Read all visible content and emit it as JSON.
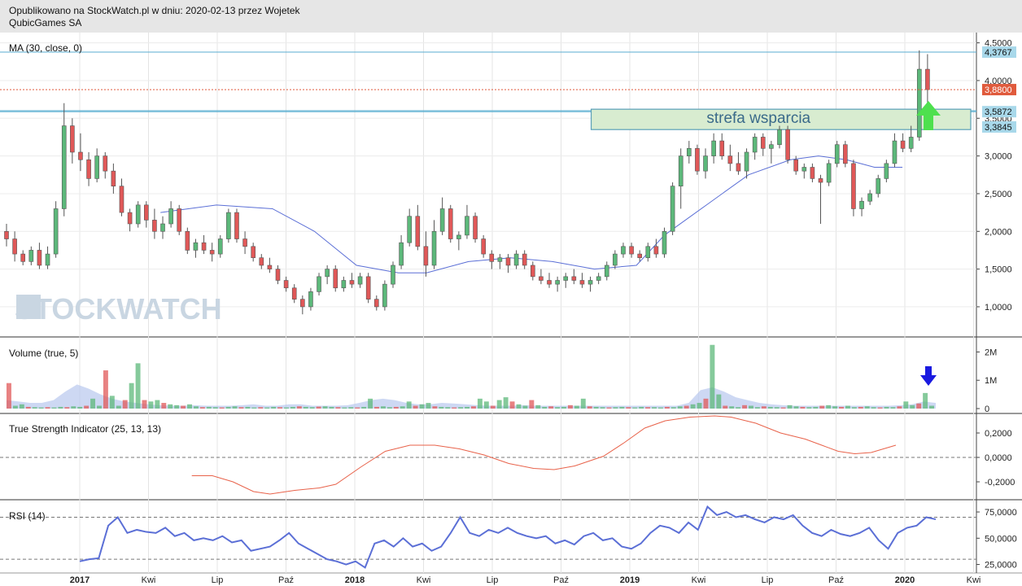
{
  "header": {
    "line1": "Opublikowano na StockWatch.pl w dniu: 2020-02-13 przez Wojetek",
    "line2": "QubicGames SA"
  },
  "watermark": "STOCKWATCH",
  "colors": {
    "up": "#5cb87a",
    "down": "#e05858",
    "ma": "#5b6fd6",
    "tsi": "#e8624a",
    "rsi": "#5b6fd6",
    "vol_ma": "#b8c8ee",
    "zone_fill": "#d8ecd0",
    "zone_border": "#5aa0b8",
    "hline": "#5aaed0",
    "price_line": "#e05a3c",
    "up_arrow": "#4ee04e",
    "down_arrow": "#1a1ae0"
  },
  "x_axis": {
    "tick_labels": [
      "2017",
      "Kwi",
      "Lip",
      "Paź",
      "2018",
      "Kwi",
      "Lip",
      "Paź",
      "2019",
      "Kwi",
      "Lip",
      "Paź",
      "2020",
      "Kwi"
    ]
  },
  "chart_data": [
    {
      "type": "candlestick",
      "title": "MA (30, close, 0)",
      "y_ticks": [
        "4,5000",
        "4,0000",
        "3,5000",
        "3,0000",
        "2,5000",
        "2,0000",
        "1,5000",
        "1,0000"
      ],
      "ylim": [
        0.6,
        4.55
      ],
      "price_labels": [
        {
          "value": 4.3767,
          "text": "4,3767",
          "kind": "line"
        },
        {
          "value": 3.88,
          "text": "3,8800",
          "kind": "price"
        },
        {
          "value": 3.5872,
          "text": "3,5872",
          "kind": "line"
        },
        {
          "value": 3.3845,
          "text": "3,3845",
          "kind": "ma"
        }
      ],
      "horizontal_lines": [
        4.3767,
        3.6,
        3.5872
      ],
      "zone": {
        "label": "strefa wsparcia",
        "low": 3.35,
        "high": 3.62,
        "from_week": 142
      },
      "candles_ohlc_weekly": [
        [
          2.0,
          2.1,
          1.8,
          1.9
        ],
        [
          1.9,
          2.0,
          1.6,
          1.7
        ],
        [
          1.7,
          1.75,
          1.55,
          1.6
        ],
        [
          1.6,
          1.8,
          1.55,
          1.75
        ],
        [
          1.75,
          1.85,
          1.5,
          1.55
        ],
        [
          1.55,
          1.8,
          1.5,
          1.7
        ],
        [
          1.7,
          2.4,
          1.65,
          2.3
        ],
        [
          2.3,
          3.7,
          2.2,
          3.4
        ],
        [
          3.4,
          3.5,
          2.9,
          3.05
        ],
        [
          3.05,
          3.3,
          2.8,
          2.95
        ],
        [
          2.95,
          3.05,
          2.6,
          2.7
        ],
        [
          2.7,
          3.1,
          2.65,
          3.0
        ],
        [
          3.0,
          3.05,
          2.7,
          2.8
        ],
        [
          2.8,
          2.9,
          2.5,
          2.6
        ],
        [
          2.6,
          2.7,
          2.2,
          2.25
        ],
        [
          2.25,
          2.3,
          2.0,
          2.1
        ],
        [
          2.1,
          2.4,
          2.05,
          2.35
        ],
        [
          2.35,
          2.4,
          2.05,
          2.15
        ],
        [
          2.15,
          2.3,
          1.9,
          2.0
        ],
        [
          2.0,
          2.2,
          1.9,
          2.1
        ],
        [
          2.1,
          2.4,
          2.05,
          2.3
        ],
        [
          2.3,
          2.35,
          1.95,
          2.0
        ],
        [
          2.0,
          2.05,
          1.7,
          1.75
        ],
        [
          1.75,
          1.9,
          1.65,
          1.85
        ],
        [
          1.85,
          1.95,
          1.7,
          1.75
        ],
        [
          1.75,
          1.85,
          1.6,
          1.7
        ],
        [
          1.7,
          1.95,
          1.65,
          1.9
        ],
        [
          1.9,
          2.3,
          1.85,
          2.25
        ],
        [
          2.25,
          2.3,
          1.85,
          1.9
        ],
        [
          1.9,
          2.0,
          1.7,
          1.8
        ],
        [
          1.8,
          1.85,
          1.6,
          1.65
        ],
        [
          1.65,
          1.7,
          1.5,
          1.55
        ],
        [
          1.55,
          1.65,
          1.45,
          1.5
        ],
        [
          1.5,
          1.55,
          1.3,
          1.35
        ],
        [
          1.35,
          1.4,
          1.2,
          1.25
        ],
        [
          1.25,
          1.3,
          1.05,
          1.1
        ],
        [
          1.1,
          1.15,
          0.9,
          1.0
        ],
        [
          1.0,
          1.25,
          0.95,
          1.2
        ],
        [
          1.2,
          1.45,
          1.15,
          1.4
        ],
        [
          1.4,
          1.55,
          1.3,
          1.5
        ],
        [
          1.5,
          1.55,
          1.2,
          1.25
        ],
        [
          1.25,
          1.4,
          1.2,
          1.35
        ],
        [
          1.35,
          1.45,
          1.25,
          1.3
        ],
        [
          1.3,
          1.45,
          1.25,
          1.4
        ],
        [
          1.4,
          1.45,
          1.05,
          1.1
        ],
        [
          1.1,
          1.15,
          0.95,
          1.0
        ],
        [
          1.0,
          1.35,
          0.95,
          1.3
        ],
        [
          1.3,
          1.6,
          1.25,
          1.55
        ],
        [
          1.55,
          1.95,
          1.5,
          1.85
        ],
        [
          1.85,
          2.3,
          1.8,
          2.2
        ],
        [
          2.2,
          2.35,
          1.75,
          1.8
        ],
        [
          1.8,
          2.0,
          1.4,
          1.55
        ],
        [
          1.55,
          2.15,
          1.5,
          2.0
        ],
        [
          2.0,
          2.45,
          1.95,
          2.3
        ],
        [
          2.3,
          2.35,
          1.85,
          1.9
        ],
        [
          1.9,
          2.0,
          1.75,
          1.95
        ],
        [
          1.95,
          2.35,
          1.9,
          2.2
        ],
        [
          2.2,
          2.25,
          1.85,
          1.9
        ],
        [
          1.9,
          1.95,
          1.65,
          1.7
        ],
        [
          1.7,
          1.75,
          1.5,
          1.6
        ],
        [
          1.6,
          1.7,
          1.5,
          1.65
        ],
        [
          1.65,
          1.7,
          1.45,
          1.55
        ],
        [
          1.55,
          1.75,
          1.5,
          1.7
        ],
        [
          1.7,
          1.75,
          1.5,
          1.55
        ],
        [
          1.55,
          1.6,
          1.35,
          1.4
        ],
        [
          1.4,
          1.5,
          1.3,
          1.35
        ],
        [
          1.35,
          1.45,
          1.25,
          1.3
        ],
        [
          1.3,
          1.4,
          1.2,
          1.35
        ],
        [
          1.35,
          1.45,
          1.25,
          1.4
        ],
        [
          1.4,
          1.5,
          1.3,
          1.35
        ],
        [
          1.35,
          1.45,
          1.25,
          1.3
        ],
        [
          1.3,
          1.4,
          1.2,
          1.35
        ],
        [
          1.35,
          1.45,
          1.3,
          1.4
        ],
        [
          1.4,
          1.6,
          1.35,
          1.55
        ],
        [
          1.55,
          1.75,
          1.5,
          1.7
        ],
        [
          1.7,
          1.85,
          1.65,
          1.8
        ],
        [
          1.8,
          1.85,
          1.65,
          1.7
        ],
        [
          1.7,
          1.75,
          1.6,
          1.65
        ],
        [
          1.65,
          1.85,
          1.6,
          1.8
        ],
        [
          1.8,
          1.9,
          1.65,
          1.7
        ],
        [
          1.7,
          2.05,
          1.65,
          2.0
        ],
        [
          2.0,
          2.65,
          1.95,
          2.6
        ],
        [
          2.6,
          3.1,
          2.3,
          3.0
        ],
        [
          3.0,
          3.2,
          2.9,
          3.1
        ],
        [
          3.1,
          3.15,
          2.75,
          2.8
        ],
        [
          2.8,
          3.1,
          2.7,
          3.0
        ],
        [
          3.0,
          3.3,
          2.9,
          3.2
        ],
        [
          3.2,
          3.3,
          2.95,
          3.0
        ],
        [
          3.0,
          3.15,
          2.8,
          2.9
        ],
        [
          2.9,
          3.05,
          2.75,
          2.8
        ],
        [
          2.8,
          3.1,
          2.7,
          3.05
        ],
        [
          3.05,
          3.3,
          2.95,
          3.25
        ],
        [
          3.25,
          3.3,
          3.0,
          3.1
        ],
        [
          3.1,
          3.2,
          2.9,
          3.15
        ],
        [
          3.15,
          3.4,
          3.1,
          3.35
        ],
        [
          3.35,
          3.4,
          2.9,
          2.95
        ],
        [
          2.95,
          3.0,
          2.75,
          2.8
        ],
        [
          2.8,
          2.9,
          2.7,
          2.85
        ],
        [
          2.85,
          2.9,
          2.65,
          2.7
        ],
        [
          2.7,
          2.75,
          2.1,
          2.65
        ],
        [
          2.65,
          2.95,
          2.6,
          2.9
        ],
        [
          2.9,
          3.2,
          2.85,
          3.15
        ],
        [
          3.15,
          3.2,
          2.85,
          2.9
        ],
        [
          2.9,
          2.95,
          2.2,
          2.3
        ],
        [
          2.3,
          2.45,
          2.2,
          2.4
        ],
        [
          2.4,
          2.55,
          2.35,
          2.5
        ],
        [
          2.5,
          2.75,
          2.45,
          2.7
        ],
        [
          2.7,
          2.95,
          2.65,
          2.9
        ],
        [
          2.9,
          3.3,
          2.85,
          3.2
        ],
        [
          3.2,
          3.3,
          3.05,
          3.1
        ],
        [
          3.1,
          3.4,
          3.05,
          3.25
        ],
        [
          3.25,
          4.4,
          3.2,
          4.15
        ],
        [
          4.15,
          4.35,
          3.7,
          3.88
        ]
      ],
      "ma_30": [
        [
          22,
          2.25
        ],
        [
          30,
          2.35
        ],
        [
          38,
          2.3
        ],
        [
          44,
          2.0
        ],
        [
          50,
          1.55
        ],
        [
          56,
          1.45
        ],
        [
          60,
          1.45
        ],
        [
          66,
          1.6
        ],
        [
          72,
          1.65
        ],
        [
          78,
          1.6
        ],
        [
          84,
          1.5
        ],
        [
          90,
          1.55
        ],
        [
          94,
          1.95
        ],
        [
          100,
          2.35
        ],
        [
          106,
          2.75
        ],
        [
          112,
          2.95
        ],
        [
          116,
          3.0
        ],
        [
          120,
          2.95
        ],
        [
          124,
          2.85
        ],
        [
          128,
          2.85
        ]
      ]
    },
    {
      "type": "bar",
      "title": "Volume (true, 5)",
      "y_ticks": [
        "2M",
        "1M",
        "0"
      ],
      "ylim": [
        0,
        2.3
      ],
      "values_millions": [
        0.9,
        0.1,
        0.15,
        0.06,
        0.05,
        0.04,
        0.05,
        0.04,
        0.06,
        0.05,
        0.08,
        0.06,
        0.1,
        0.35,
        0.1,
        1.35,
        0.45,
        0.1,
        0.3,
        0.9,
        1.6,
        0.3,
        0.25,
        0.3,
        0.2,
        0.15,
        0.12,
        0.1,
        0.15,
        0.08,
        0.05,
        0.06,
        0.05,
        0.04,
        0.06,
        0.08,
        0.05,
        0.06,
        0.04,
        0.05,
        0.04,
        0.06,
        0.05,
        0.04,
        0.06,
        0.08,
        0.06,
        0.05,
        0.07,
        0.08,
        0.06,
        0.05,
        0.04,
        0.05,
        0.04,
        0.06,
        0.35,
        0.06,
        0.08,
        0.05,
        0.06,
        0.08,
        0.25,
        0.1,
        0.15,
        0.2,
        0.08,
        0.06,
        0.05,
        0.04,
        0.05,
        0.06,
        0.08,
        0.35,
        0.25,
        0.1,
        0.3,
        0.4,
        0.25,
        0.15,
        0.1,
        0.3,
        0.12,
        0.06,
        0.08,
        0.05,
        0.06,
        0.12,
        0.1,
        0.35,
        0.08,
        0.06,
        0.05,
        0.04,
        0.05,
        0.06,
        0.05,
        0.04,
        0.06,
        0.05,
        0.05,
        0.04,
        0.06,
        0.05,
        0.08,
        0.1,
        0.15,
        0.2,
        0.35,
        2.25,
        0.5,
        0.1,
        0.08,
        0.05,
        0.12,
        0.1,
        0.05,
        0.08,
        0.06,
        0.05,
        0.04,
        0.12,
        0.08,
        0.06,
        0.05,
        0.06,
        0.1,
        0.12,
        0.08,
        0.06,
        0.1,
        0.05,
        0.06,
        0.08,
        0.05,
        0.04,
        0.06,
        0.05,
        0.08,
        0.25,
        0.12,
        0.18,
        0.55,
        0.1
      ],
      "volume_ma_millions": [
        0.3,
        0.25,
        0.2,
        0.2,
        0.3,
        0.6,
        0.85,
        0.7,
        0.5,
        0.35,
        0.25,
        0.2,
        0.15,
        0.12,
        0.1,
        0.1,
        0.12,
        0.1,
        0.1,
        0.1,
        0.12,
        0.15,
        0.1,
        0.1,
        0.15,
        0.15,
        0.1,
        0.1,
        0.1,
        0.12,
        0.2,
        0.3,
        0.35,
        0.3,
        0.2,
        0.15,
        0.15,
        0.2,
        0.18,
        0.15,
        0.12,
        0.1,
        0.1,
        0.1,
        0.12,
        0.1,
        0.1,
        0.1,
        0.1,
        0.1,
        0.1,
        0.1,
        0.1,
        0.1,
        0.1,
        0.1,
        0.1,
        0.1,
        0.2,
        0.65,
        0.75,
        0.6,
        0.4,
        0.3,
        0.2,
        0.15,
        0.12,
        0.1,
        0.1,
        0.1,
        0.1,
        0.1,
        0.1,
        0.1,
        0.1,
        0.1,
        0.12,
        0.15,
        0.25,
        0.2
      ]
    },
    {
      "type": "line",
      "title": "True Strength Indicator (25, 13, 13)",
      "y_ticks": [
        "0,2000",
        "0,0000",
        "-0,2000"
      ],
      "ylim": [
        -0.32,
        0.32
      ],
      "points_week_value": [
        [
          45,
          -0.15
        ],
        [
          50,
          -0.15
        ],
        [
          55,
          -0.2
        ],
        [
          60,
          -0.28
        ],
        [
          64,
          -0.3
        ],
        [
          70,
          -0.27
        ],
        [
          76,
          -0.25
        ],
        [
          80,
          -0.22
        ],
        [
          86,
          -0.08
        ],
        [
          92,
          0.05
        ],
        [
          98,
          0.1
        ],
        [
          104,
          0.1
        ],
        [
          110,
          0.07
        ],
        [
          116,
          0.02
        ],
        [
          122,
          -0.05
        ],
        [
          128,
          -0.09
        ],
        [
          133,
          -0.1
        ],
        [
          138,
          -0.07
        ],
        [
          145,
          0.01
        ],
        [
          150,
          0.12
        ],
        [
          155,
          0.24
        ],
        [
          160,
          0.3
        ],
        [
          166,
          0.33
        ],
        [
          172,
          0.34
        ],
        [
          176,
          0.33
        ],
        [
          182,
          0.28
        ],
        [
          188,
          0.2
        ],
        [
          194,
          0.15
        ],
        [
          198,
          0.1
        ],
        [
          202,
          0.05
        ],
        [
          206,
          0.03
        ],
        [
          210,
          0.04
        ],
        [
          214,
          0.08
        ],
        [
          216,
          0.1
        ]
      ]
    },
    {
      "type": "line",
      "title": "RSI (14)",
      "y_ticks": [
        "75,0000",
        "50,0000",
        "25,0000"
      ],
      "ylim": [
        20,
        82
      ],
      "levels": [
        70,
        30
      ],
      "values": [
        28,
        30,
        31,
        62,
        70,
        55,
        58,
        56,
        55,
        60,
        52,
        55,
        48,
        50,
        48,
        52,
        46,
        48,
        38,
        40,
        42,
        48,
        55,
        45,
        40,
        35,
        30,
        28,
        25,
        28,
        22,
        45,
        48,
        42,
        50,
        42,
        45,
        38,
        42,
        55,
        70,
        55,
        52,
        58,
        55,
        60,
        55,
        52,
        50,
        52,
        45,
        48,
        44,
        52,
        55,
        48,
        50,
        42,
        40,
        45,
        55,
        62,
        60,
        55,
        65,
        58,
        80,
        72,
        75,
        70,
        72,
        68,
        65,
        70,
        68,
        72,
        62,
        55,
        52,
        58,
        54,
        52,
        55,
        60,
        48,
        40,
        55,
        60,
        62,
        70,
        68
      ]
    }
  ]
}
